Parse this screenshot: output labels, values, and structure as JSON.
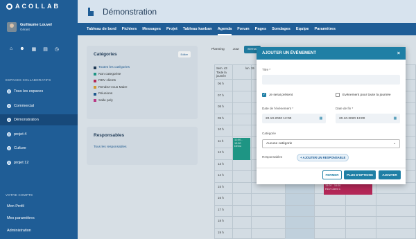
{
  "app": {
    "name": "ACOLLAB"
  },
  "user": {
    "name": "Guillaume Louvel",
    "role": "Gérant"
  },
  "quick_icons": [
    "home-icon",
    "users-icon",
    "calendar-icon",
    "document-icon",
    "clock-icon"
  ],
  "sidebar": {
    "collab_section": "ESPACES COLLABORATIFS",
    "items": [
      {
        "label": "Tous les espaces",
        "active": false
      },
      {
        "label": "Commercial",
        "active": false
      },
      {
        "label": "Démonstration",
        "active": true
      },
      {
        "label": "projet 4",
        "active": false
      },
      {
        "label": "Culture",
        "active": false
      },
      {
        "label": "projet 12",
        "active": false
      }
    ],
    "account_section": "VOTRE COMPTE",
    "account_items": [
      {
        "label": "Mon Profil"
      },
      {
        "label": "Mes paramètres"
      },
      {
        "label": "Administration"
      }
    ]
  },
  "header": {
    "title": "Démonstration"
  },
  "nav": {
    "items": [
      {
        "label": "Tableau de bord",
        "active": false
      },
      {
        "label": "Fichiers",
        "active": false
      },
      {
        "label": "Messages",
        "active": false
      },
      {
        "label": "Projet",
        "active": false
      },
      {
        "label": "Tableau kanban",
        "active": false
      },
      {
        "label": "Agenda",
        "active": true
      },
      {
        "label": "Forum",
        "active": false
      },
      {
        "label": "Pages",
        "active": false
      },
      {
        "label": "Sondages",
        "active": false
      },
      {
        "label": "Equipe",
        "active": false
      },
      {
        "label": "Paramètres",
        "active": false
      }
    ]
  },
  "categories": {
    "title": "Catégories",
    "edit_label": "Editer",
    "items": [
      {
        "label": "Toutes les catégories",
        "color": "#1f3a57"
      },
      {
        "label": "Non categorise",
        "color": "#1f9e8a"
      },
      {
        "label": "RDV clients",
        "color": "#c0265a"
      },
      {
        "label": "Rendez-vous Maire",
        "color": "#e0a030"
      },
      {
        "label": "Réunions",
        "color": "#1f5d96"
      },
      {
        "label": "Salle poly",
        "color": "#c73a8a"
      }
    ]
  },
  "responsables": {
    "title": "Responsables",
    "link": "Tous les responsables"
  },
  "calendar": {
    "tabs": [
      {
        "label": "Planning",
        "active": false
      },
      {
        "label": "Jour",
        "active": false
      },
      {
        "label": "Semai",
        "active": true
      }
    ],
    "week_label": "Sem. 43",
    "allday_label": "Toute la journée",
    "day_label": "lun. 19",
    "hours": [
      "06 h",
      "07 h",
      "08 h",
      "09 h",
      "10 h",
      "11 h",
      "12 h",
      "13 h",
      "14 h",
      "15 h",
      "16 h",
      "17 h",
      "18 h",
      "19 h"
    ],
    "events": [
      {
        "time": "11:00 - 13:00",
        "title": "Démo",
        "color": "#1f9e8a"
      },
      {
        "time": "15:00 - 16:00",
        "title": "RDV Client 1",
        "color": "#c0265a"
      }
    ]
  },
  "modal": {
    "title": "AJOUTER UN ÉVÉNEMENT",
    "close": "×",
    "title_label": "Titre *",
    "title_value": "",
    "present_label": "Je serai présent",
    "present_checked": true,
    "allday_label": "Evénement pour toute la journée",
    "allday_checked": false,
    "start_label": "Date de l'évènement *",
    "start_value": "20.10.2020 12:00",
    "end_label": "Date de fin *",
    "end_value": "20.10.2020 13:00",
    "category_label": "Catégorie",
    "category_value": "Aucune catégorie",
    "responsables_label": "Responsables",
    "add_resp_label": "+ AJOUTER UN RESPONSABLE",
    "buttons": {
      "close": "FERMER",
      "more": "PLUS D'OPTIONS",
      "add": "AJOUTER"
    }
  }
}
